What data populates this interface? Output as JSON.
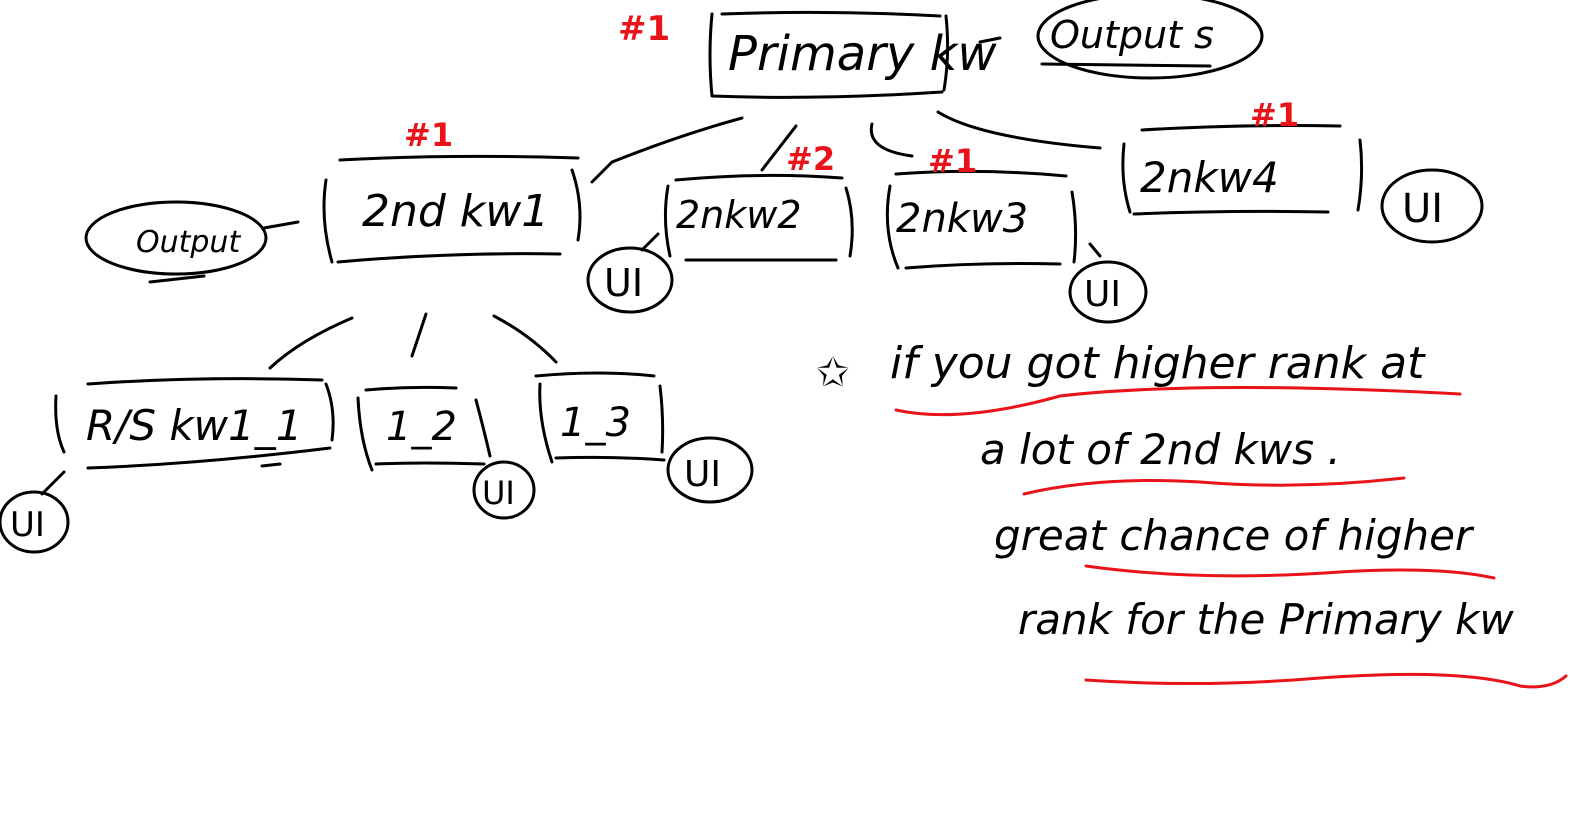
{
  "colors": {
    "ink": "#000000",
    "annotation": "#e8141a"
  },
  "nodes": {
    "primary": {
      "label": "Primary kw",
      "rank": "#1"
    },
    "primary_output": {
      "label": "Output s"
    },
    "kw1": {
      "label": "2nd kw1",
      "rank": "#1"
    },
    "kw1_output": {
      "label": "Output"
    },
    "kw2": {
      "label": "2nkw2",
      "rank": "#2"
    },
    "kw3": {
      "label": "2nkw3",
      "rank": "#1"
    },
    "kw4": {
      "label": "2nkw4",
      "rank": "#1"
    },
    "rs1": {
      "label": "R/S kw1_1"
    },
    "rs2": {
      "label": "1_2"
    },
    "rs3": {
      "label": "1_3"
    }
  },
  "ui_label": "UI",
  "note": {
    "star": "✩",
    "lines": [
      "if you got higher rank at",
      "a lot of 2nd kws .",
      "great chance of higher",
      "rank for the Primary kw"
    ]
  }
}
